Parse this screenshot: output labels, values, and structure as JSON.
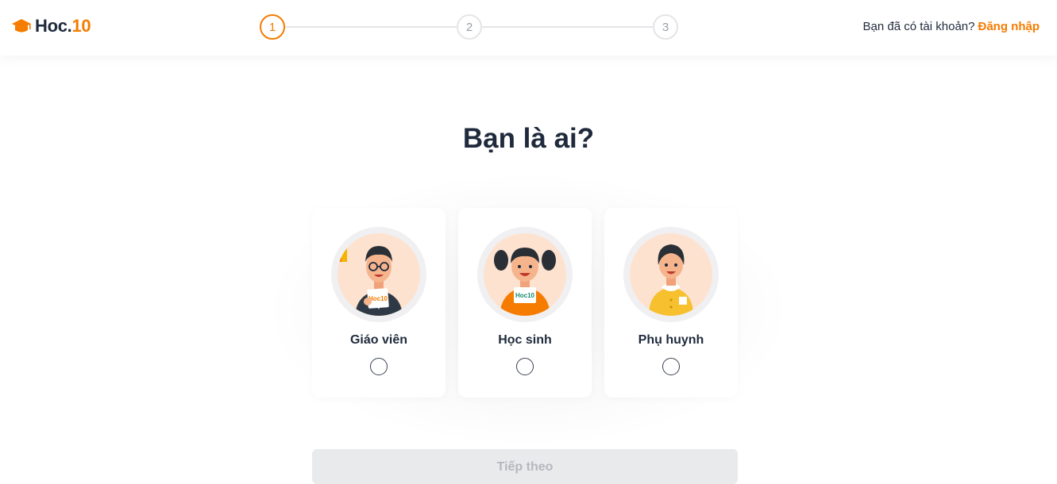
{
  "header": {
    "logo_text": "Hoc.",
    "logo_num": "10",
    "steps": [
      "1",
      "2",
      "3"
    ],
    "active_step": 1,
    "login_prompt": "Bạn đã có tài khoản?",
    "login_link": "Đăng nhập"
  },
  "main": {
    "title": "Bạn là ai?",
    "roles": [
      {
        "label": "Giáo viên",
        "badge": "Hoc10",
        "selected": false
      },
      {
        "label": "Học sinh",
        "badge": "Hoc10",
        "selected": false
      },
      {
        "label": "Phụ huynh",
        "selected": false
      }
    ],
    "continue_label": "Tiếp theo"
  },
  "colors": {
    "accent": "#f57c00",
    "text": "#1f2a3c",
    "muted": "#9aa0a8",
    "disabled_bg": "#e9eaec"
  }
}
